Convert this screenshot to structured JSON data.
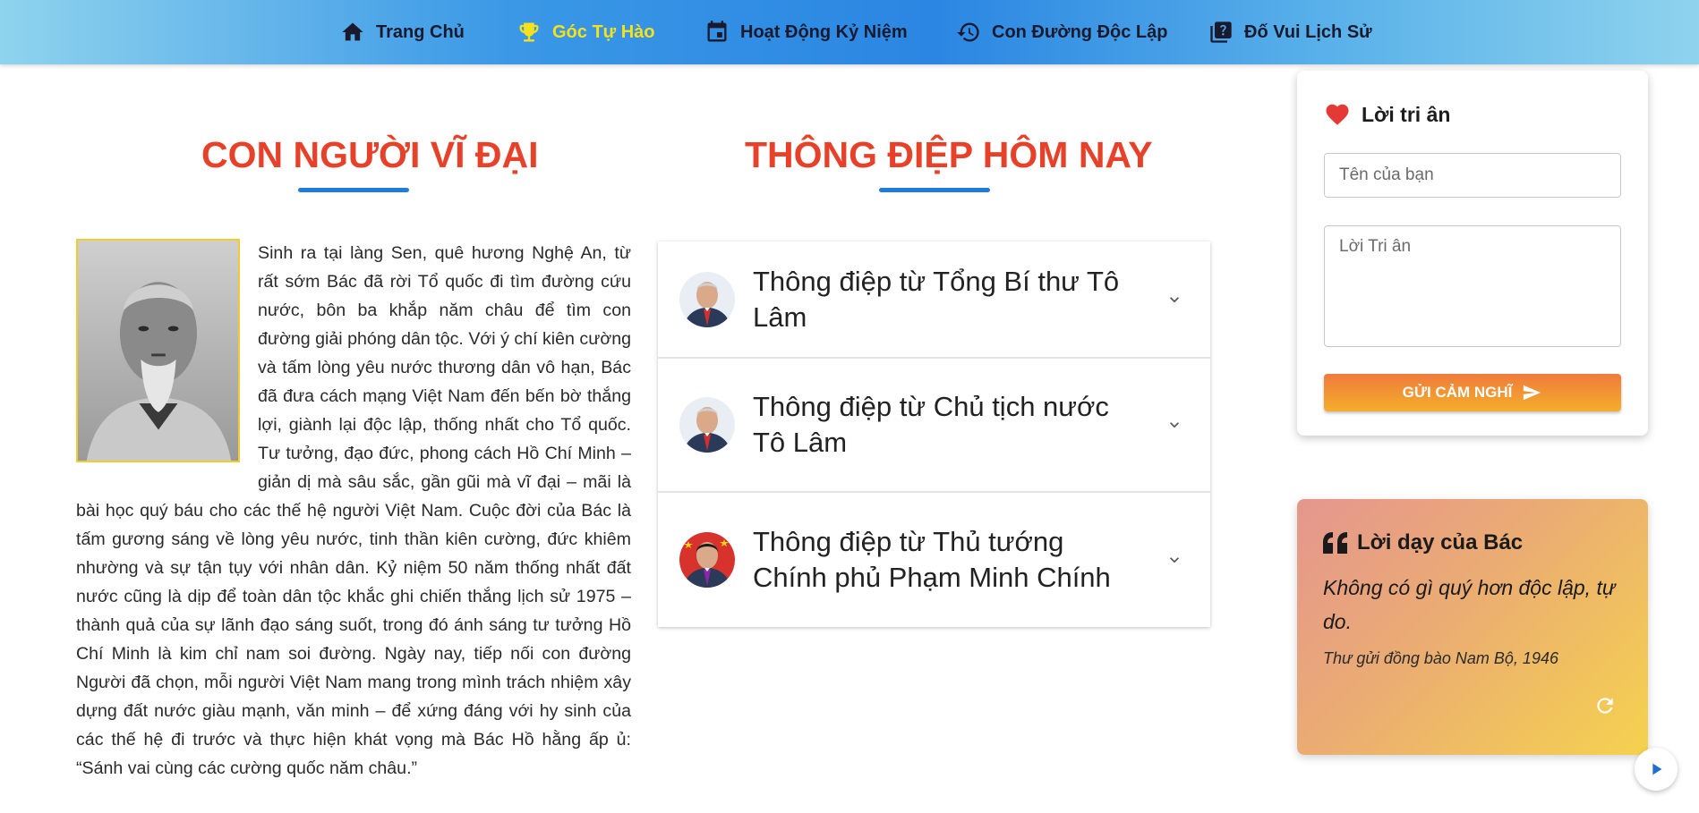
{
  "nav": {
    "items": [
      {
        "label": "Trang Chủ",
        "icon": "home-icon"
      },
      {
        "label": "Góc Tự Hào",
        "icon": "trophy-icon",
        "active": true
      },
      {
        "label": "Hoạt Động Kỷ Niệm",
        "icon": "calendar-icon"
      },
      {
        "label": "Con Đường Độc Lập",
        "icon": "history-icon"
      },
      {
        "label": "Đố Vui Lịch Sử",
        "icon": "quiz-icon"
      }
    ],
    "active_color": "#f7e11a"
  },
  "sections": {
    "left_title": "CON NGƯỜI VĨ ĐẠI",
    "middle_title": "THÔNG ĐIỆP HÔM NAY",
    "title_color": "#e8412a",
    "underline_color": "#1e7be0"
  },
  "biography": {
    "text": "Sinh ra tại làng Sen, quê hương Nghệ An, từ rất sớm Bác đã rời Tổ quốc đi tìm đường cứu nước, bôn ba khắp năm châu để tìm con đường giải phóng dân tộc. Với ý chí kiên cường và tấm lòng yêu nước thương dân vô hạn, Bác đã đưa cách mạng Việt Nam đến bến bờ thắng lợi, giành lại độc lập, thống nhất cho Tổ quốc. Tư tưởng, đạo đức, phong cách Hồ Chí Minh – giản dị mà sâu sắc, gần gũi mà vĩ đại – mãi là bài học quý báu cho các thế hệ người Việt Nam. Cuộc đời của Bác là tấm gương sáng về lòng yêu nước, tinh thần kiên cường, đức khiêm nhường và sự tận tụy với nhân dân. Kỷ niệm 50 năm thống nhất đất nước cũng là dịp để toàn dân tộc khắc ghi chiến thắng lịch sử 1975 – thành quả của sự lãnh đạo sáng suốt, trong đó ánh sáng tư tưởng Hồ Chí Minh là kim chỉ nam soi đường. Ngày nay, tiếp nối con đường Người đã chọn, mỗi người Việt Nam mang trong mình trách nhiệm xây dựng đất nước giàu mạnh, văn minh – để xứng đáng với hy sinh của các thế hệ đi trước và thực hiện khát vọng mà Bác Hồ hằng ấp ủ: “Sánh vai cùng các cường quốc năm châu.”"
  },
  "messages": [
    {
      "title": "Thông điệp từ Tổng Bí thư Tô Lâm"
    },
    {
      "title": "Thông điệp từ Chủ tịch nước Tô Lâm"
    },
    {
      "title": "Thông điệp từ Thủ tướng Chính phủ Phạm Minh Chính"
    }
  ],
  "gratitude": {
    "title": "Lời tri ân",
    "name_placeholder": "Tên của bạn",
    "message_placeholder": "Lời Tri ân",
    "submit_label": "GỬI CẢM NGHĨ",
    "heart_color": "#e53935"
  },
  "quote": {
    "title": "Lời dạy của Bác",
    "text": "Không có gì quý hơn độc lập, tự do.",
    "source": "Thư gửi đồng bào Nam Bộ, 1946"
  }
}
